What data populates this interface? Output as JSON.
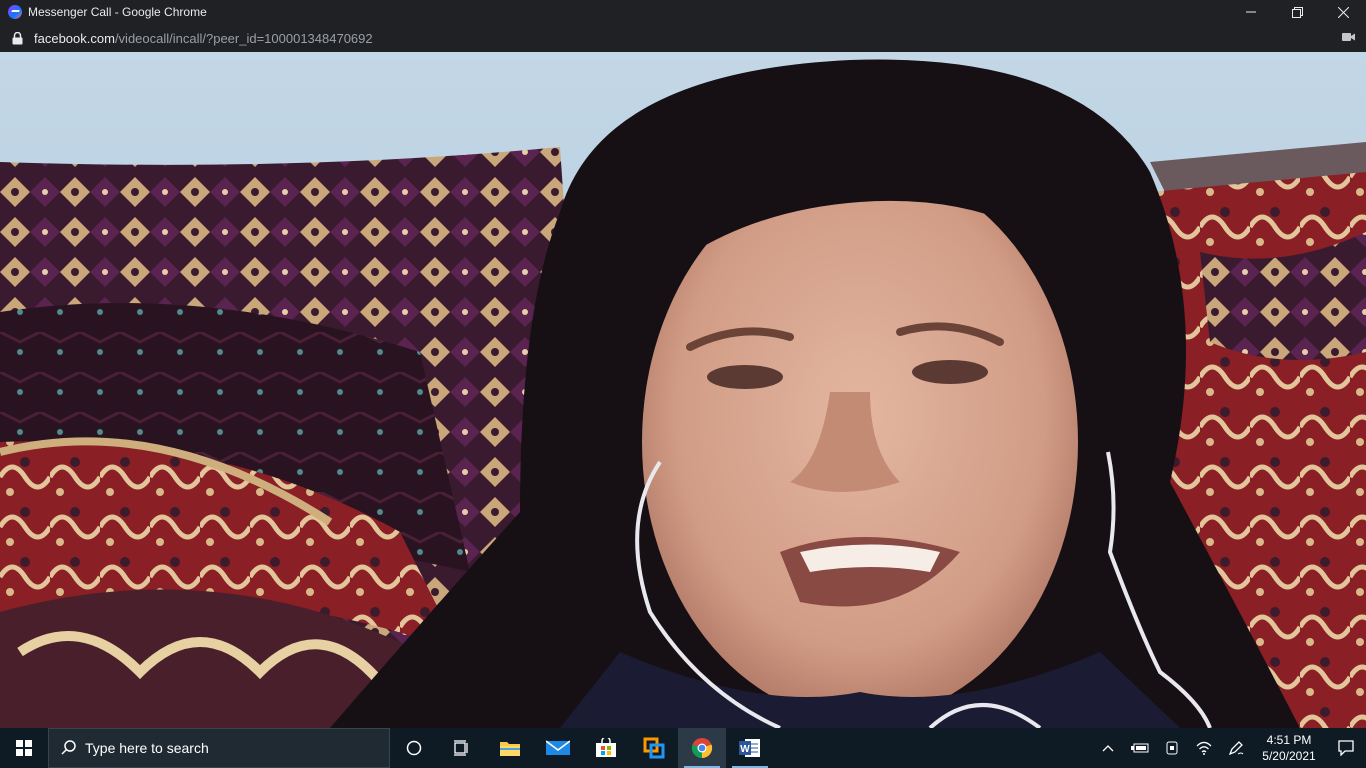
{
  "window": {
    "title": "Messenger Call - Google Chrome"
  },
  "address_bar": {
    "host": "facebook.com",
    "path": "/videocall/incall/?peer_id=100001348470692"
  },
  "taskbar": {
    "search_placeholder": "Type here to search",
    "pinned_apps": [
      "cortana-icon",
      "task-view-icon",
      "file-explorer-icon",
      "mail-icon",
      "store-icon",
      "sync-app-icon",
      "chrome-icon",
      "word-icon"
    ]
  },
  "clock": {
    "time": "4:51 PM",
    "date": "5/20/2021"
  },
  "colors": {
    "chrome_bg": "#202124",
    "taskbar_bg": "#0e1a24",
    "wall": "#b7cfe0"
  }
}
